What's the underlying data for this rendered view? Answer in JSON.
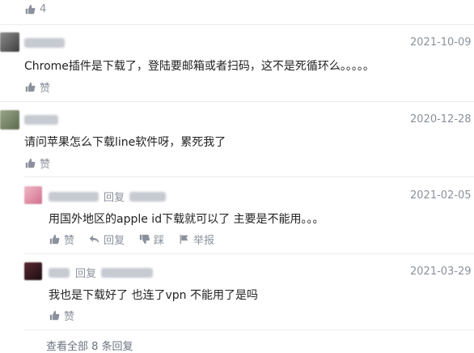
{
  "top": {
    "like_count": "4"
  },
  "comments": [
    {
      "date": "2021-10-09",
      "text": "Chrome插件是下载了，登陆要邮箱或者扫码，这不是死循环么。。。。。",
      "like_label": "赞"
    },
    {
      "date": "2020-12-28",
      "text": "请问苹果怎么下载line软件呀，累死我了",
      "like_label": "赞"
    }
  ],
  "replies": [
    {
      "reply_label": "回复",
      "date": "2021-02-05",
      "text": "用国外地区的apple id下载就可以了 主要是不能用。。。",
      "actions": {
        "like": "赞",
        "reply": "回复",
        "dislike": "踩",
        "report": "举报"
      }
    },
    {
      "reply_label": "回复",
      "date": "2021-03-29",
      "text": "我也是下载好了 也连了vpn 不能用了是吗",
      "like_label": "赞"
    }
  ],
  "view_all": "查看全部 8 条回复",
  "colors": {
    "muted": "#8a919c",
    "text": "#222222",
    "divider": "#ececec"
  }
}
